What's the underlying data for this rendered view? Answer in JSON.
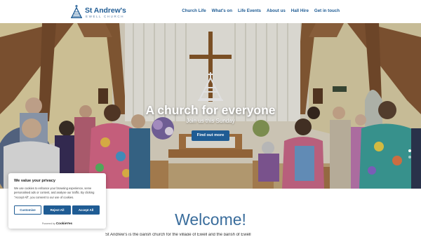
{
  "header": {
    "logo": {
      "title": "St Andrew's",
      "subtitle": "EWELL CHURCH"
    },
    "nav": [
      "Church Life",
      "What's on",
      "Life Events",
      "About us",
      "Hall Hire",
      "Get in touch"
    ]
  },
  "hero": {
    "title": "A church for everyone",
    "subtitle": "Join us this Sunday",
    "button_label": "Find out more",
    "slides": 2,
    "active_slide": 1
  },
  "welcome": {
    "heading": "Welcome!",
    "intro": "St Andrew's is the parish church for the village of Ewell and the parish of Ewell"
  },
  "cookie_banner": {
    "title": "We value your privacy",
    "text": "We use cookies to enhance your browsing experience, serve personalised ads or content, and analyse our traffic. By clicking \"Accept All\", you consent to our use of cookies.",
    "customise_label": "Customise",
    "reject_label": "Reject All",
    "accept_label": "Accept All",
    "powered_by": "Powered by",
    "powered_brand": "CookieYes"
  },
  "colors": {
    "brand_blue": "#1f5c94",
    "welcome_blue": "#3a6d9c"
  }
}
